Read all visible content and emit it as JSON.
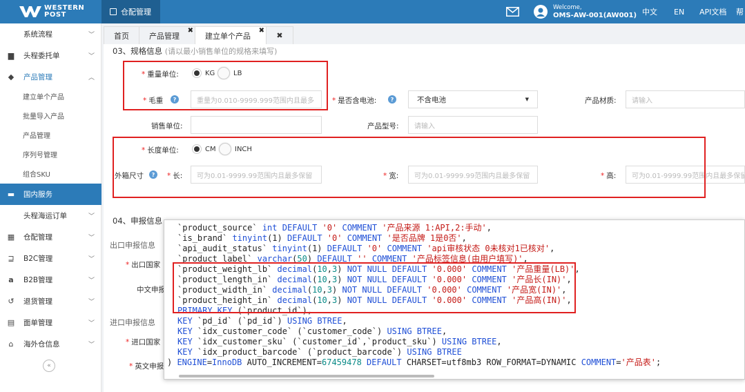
{
  "brand": {
    "logo_line1": "WESTERN",
    "logo_line2": "POST"
  },
  "topnav": {
    "active": "仓配管理",
    "welcome": "Welcome,",
    "user": "OMS-AW-001(AW001)",
    "lang_zh": "中文",
    "lang_en": "EN",
    "api_docs": "API文档",
    "help_partial": "帮"
  },
  "sidebar": {
    "items": [
      {
        "label": "系统流程"
      },
      {
        "label": "头程委托单"
      },
      {
        "label": "产品管理"
      },
      {
        "label": "建立单个产品"
      },
      {
        "label": "批量导入产品"
      },
      {
        "label": "产品管理"
      },
      {
        "label": "序列号管理"
      },
      {
        "label": "组合SKU"
      },
      {
        "label": "国内服务"
      },
      {
        "label": "头程海运订单"
      },
      {
        "label": "仓配管理"
      },
      {
        "label": "B2C管理"
      },
      {
        "label": "B2B管理"
      },
      {
        "label": "退货管理"
      },
      {
        "label": "面单管理"
      },
      {
        "label": "海外仓信息"
      }
    ],
    "collapse_glyph": "«"
  },
  "tabs": [
    {
      "label": "首页"
    },
    {
      "label": "产品管理"
    },
    {
      "label": "建立单个产品"
    }
  ],
  "tab_close": "✖",
  "form": {
    "section3_title": "03、规格信息",
    "section3_note": "(请以最小销售单位的规格来填写)",
    "weight_unit_label": "重量单位:",
    "weight_kg": "KG",
    "weight_lb": "LB",
    "gross_weight_label": "毛重",
    "gross_weight_placeholder": "重量为0.010-9999.999范围内且最多",
    "battery_label": "是否含电池:",
    "battery_value": "不含电池",
    "material_label": "产品材质:",
    "material_placeholder": "请输入",
    "sale_unit_label": "销售单位:",
    "model_label": "产品型号:",
    "model_placeholder": "请输入",
    "length_unit_label": "长度单位:",
    "length_cm": "CM",
    "length_inch": "INCH",
    "outer_size_label": "外箱尺寸",
    "length_label": "长:",
    "width_label": "宽:",
    "height_label": "高:",
    "dim_placeholder": "可为0.01-9999.99范围内且最多保留",
    "section4_title": "04、申报信息",
    "export_decl": "出口申报信息",
    "export_country": "出口国家",
    "cn_decl": "中文申报",
    "import_decl": "进口申报信息",
    "import_country": "进口国家",
    "en_decl": "英文申报"
  },
  "code_popup": {
    "lines": [
      [
        {
          "t": "`product_source` "
        },
        {
          "t": "int",
          "c": "kw"
        },
        {
          "t": " "
        },
        {
          "t": "DEFAULT",
          "c": "kw"
        },
        {
          "t": " "
        },
        {
          "t": "'0'",
          "c": "str"
        },
        {
          "t": " "
        },
        {
          "t": "COMMENT",
          "c": "kw"
        },
        {
          "t": " "
        },
        {
          "t": "'产品来源 1:API,2:手动'",
          "c": "str"
        },
        {
          "t": ","
        }
      ],
      [
        {
          "t": "`is_brand` "
        },
        {
          "t": "tinyint",
          "c": "kw"
        },
        {
          "t": "(1) "
        },
        {
          "t": "DEFAULT",
          "c": "kw"
        },
        {
          "t": " "
        },
        {
          "t": "'0'",
          "c": "str"
        },
        {
          "t": " "
        },
        {
          "t": "COMMENT",
          "c": "kw"
        },
        {
          "t": " "
        },
        {
          "t": "'是否品牌 1是0否'",
          "c": "str"
        },
        {
          "t": ","
        }
      ],
      [
        {
          "t": "`api_audit_status` "
        },
        {
          "t": "tinyint",
          "c": "kw"
        },
        {
          "t": "(1) "
        },
        {
          "t": "DEFAULT",
          "c": "kw"
        },
        {
          "t": " "
        },
        {
          "t": "'0'",
          "c": "str"
        },
        {
          "t": " "
        },
        {
          "t": "COMMENT",
          "c": "kw"
        },
        {
          "t": " "
        },
        {
          "t": "'api审核状态 0未核对1已核对'",
          "c": "str"
        },
        {
          "t": ","
        }
      ],
      [
        {
          "t": "`product_label` "
        },
        {
          "t": "varchar",
          "c": "kw"
        },
        {
          "t": "("
        },
        {
          "t": "50",
          "c": "num"
        },
        {
          "t": ") "
        },
        {
          "t": "DEFAULT",
          "c": "kw"
        },
        {
          "t": " "
        },
        {
          "t": "''",
          "c": "str"
        },
        {
          "t": " "
        },
        {
          "t": "COMMENT",
          "c": "kw"
        },
        {
          "t": " "
        },
        {
          "t": "'产品标签信息(由用户填写)'",
          "c": "str"
        },
        {
          "t": ","
        }
      ],
      [
        {
          "t": "`product_weight_lb` "
        },
        {
          "t": "decimal",
          "c": "kw"
        },
        {
          "t": "("
        },
        {
          "t": "10",
          "c": "num"
        },
        {
          "t": ","
        },
        {
          "t": "3",
          "c": "num"
        },
        {
          "t": ") "
        },
        {
          "t": "NOT NULL DEFAULT",
          "c": "kw"
        },
        {
          "t": " "
        },
        {
          "t": "'0.000'",
          "c": "str"
        },
        {
          "t": " "
        },
        {
          "t": "COMMENT",
          "c": "kw"
        },
        {
          "t": " "
        },
        {
          "t": "'产品重量(LB)'",
          "c": "str"
        },
        {
          "t": ","
        }
      ],
      [
        {
          "t": "`product_length_in` "
        },
        {
          "t": "decimal",
          "c": "kw"
        },
        {
          "t": "("
        },
        {
          "t": "10",
          "c": "num"
        },
        {
          "t": ","
        },
        {
          "t": "3",
          "c": "num"
        },
        {
          "t": ") "
        },
        {
          "t": "NOT NULL DEFAULT",
          "c": "kw"
        },
        {
          "t": " "
        },
        {
          "t": "'0.000'",
          "c": "str"
        },
        {
          "t": " "
        },
        {
          "t": "COMMENT",
          "c": "kw"
        },
        {
          "t": " "
        },
        {
          "t": "'产品长(IN)'",
          "c": "str"
        },
        {
          "t": ","
        }
      ],
      [
        {
          "t": "`product_width_in` "
        },
        {
          "t": "decimal",
          "c": "kw"
        },
        {
          "t": "("
        },
        {
          "t": "10",
          "c": "num"
        },
        {
          "t": ","
        },
        {
          "t": "3",
          "c": "num"
        },
        {
          "t": ") "
        },
        {
          "t": "NOT NULL DEFAULT",
          "c": "kw"
        },
        {
          "t": " "
        },
        {
          "t": "'0.000'",
          "c": "str"
        },
        {
          "t": " "
        },
        {
          "t": "COMMENT",
          "c": "kw"
        },
        {
          "t": " "
        },
        {
          "t": "'产品宽(IN)'",
          "c": "str"
        },
        {
          "t": ","
        }
      ],
      [
        {
          "t": "`product_height_in` "
        },
        {
          "t": "decimal",
          "c": "kw"
        },
        {
          "t": "("
        },
        {
          "t": "10",
          "c": "num"
        },
        {
          "t": ","
        },
        {
          "t": "3",
          "c": "num"
        },
        {
          "t": ") "
        },
        {
          "t": "NOT NULL DEFAULT",
          "c": "kw"
        },
        {
          "t": " "
        },
        {
          "t": "'0.000'",
          "c": "str"
        },
        {
          "t": " "
        },
        {
          "t": "COMMENT",
          "c": "kw"
        },
        {
          "t": " "
        },
        {
          "t": "'产品高(IN)'",
          "c": "str"
        },
        {
          "t": ","
        }
      ],
      [
        {
          "t": "PRIMARY KEY",
          "c": "kw"
        },
        {
          "t": " (`product_id`),"
        }
      ],
      [
        {
          "t": "KEY",
          "c": "kw"
        },
        {
          "t": " `pd_id` (`pd_id`) "
        },
        {
          "t": "USING BTREE",
          "c": "kw"
        },
        {
          "t": ","
        }
      ],
      [
        {
          "t": "KEY",
          "c": "kw"
        },
        {
          "t": " `idx_customer_code` (`customer_code`) "
        },
        {
          "t": "USING BTREE",
          "c": "kw"
        },
        {
          "t": ","
        }
      ],
      [
        {
          "t": "KEY",
          "c": "kw"
        },
        {
          "t": " `idx_customer_sku` (`customer_id`,`product_sku`) "
        },
        {
          "t": "USING BTREE",
          "c": "kw"
        },
        {
          "t": ","
        }
      ],
      [
        {
          "t": "KEY",
          "c": "kw"
        },
        {
          "t": " `idx_product_barcode` (`product_barcode`) "
        },
        {
          "t": "USING BTREE",
          "c": "kw"
        }
      ],
      [
        {
          "t": ") "
        },
        {
          "t": "ENGINE",
          "c": "kw"
        },
        {
          "t": "="
        },
        {
          "t": "InnoDB",
          "c": "kw"
        },
        {
          "t": " AUTO_INCREMENT="
        },
        {
          "t": "67459478",
          "c": "num"
        },
        {
          "t": " "
        },
        {
          "t": "DEFAULT",
          "c": "kw"
        },
        {
          "t": " CHARSET=utf8mb3 ROW_FORMAT=DYNAMIC "
        },
        {
          "t": "COMMENT",
          "c": "kw"
        },
        {
          "t": "="
        },
        {
          "t": "'产品表'",
          "c": "str"
        },
        {
          "t": ";"
        }
      ]
    ]
  }
}
